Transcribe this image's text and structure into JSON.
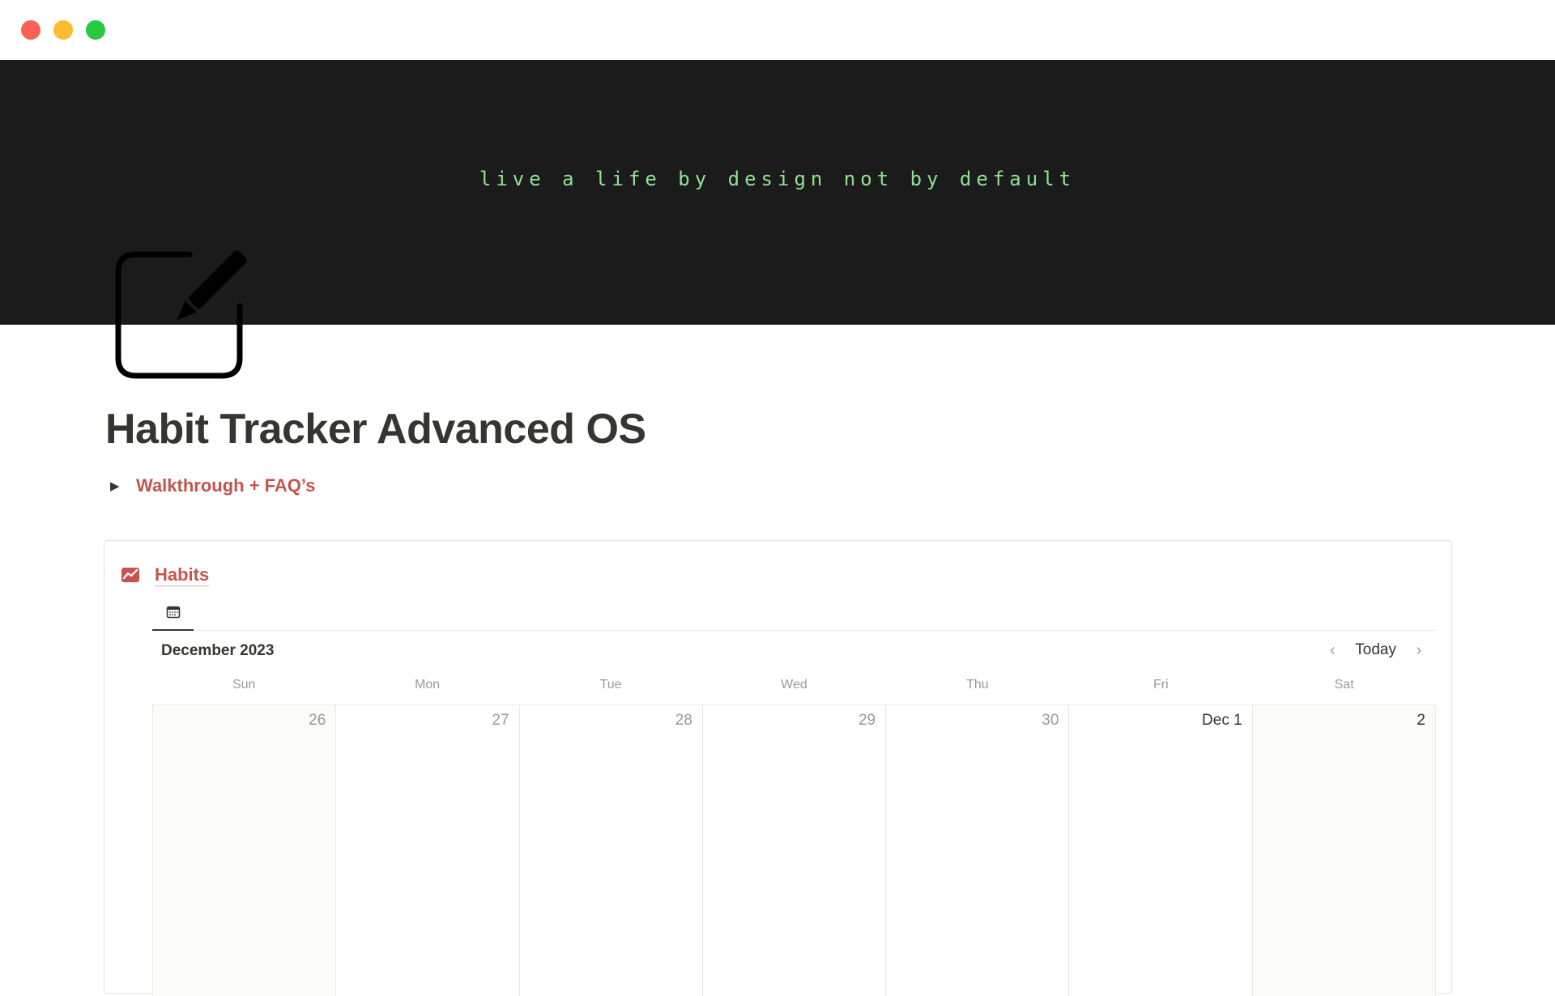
{
  "window": {
    "traffic_lights": [
      "close",
      "minimize",
      "zoom"
    ]
  },
  "cover": {
    "text": "live a life by design not by default",
    "background": "#1b1b1b",
    "text_color": "#8fe28f"
  },
  "page": {
    "icon": "edit-square-icon",
    "title": "Habit Tracker Advanced OS"
  },
  "toggle": {
    "icon": "triangle-right-icon",
    "label": "Walkthrough + FAQ’s"
  },
  "database": {
    "icon": "chart-line-icon",
    "title": "Habits",
    "view_tab_icon": "calendar-icon",
    "month_label": "December 2023",
    "nav": {
      "prev_icon": "chevron-left-icon",
      "today_label": "Today",
      "next_icon": "chevron-right-icon"
    },
    "weekdays": [
      "Sun",
      "Mon",
      "Tue",
      "Wed",
      "Thu",
      "Fri",
      "Sat"
    ],
    "days": [
      {
        "label": "26",
        "in_month": false,
        "weekend": true
      },
      {
        "label": "27",
        "in_month": false,
        "weekend": false
      },
      {
        "label": "28",
        "in_month": false,
        "weekend": false
      },
      {
        "label": "29",
        "in_month": false,
        "weekend": false
      },
      {
        "label": "30",
        "in_month": false,
        "weekend": false
      },
      {
        "label": "Dec 1",
        "in_month": true,
        "weekend": false
      },
      {
        "label": "2",
        "in_month": true,
        "weekend": true
      }
    ]
  },
  "colors": {
    "accent": "#c4554d",
    "text": "#37352f",
    "muted": "#9b9a97"
  }
}
